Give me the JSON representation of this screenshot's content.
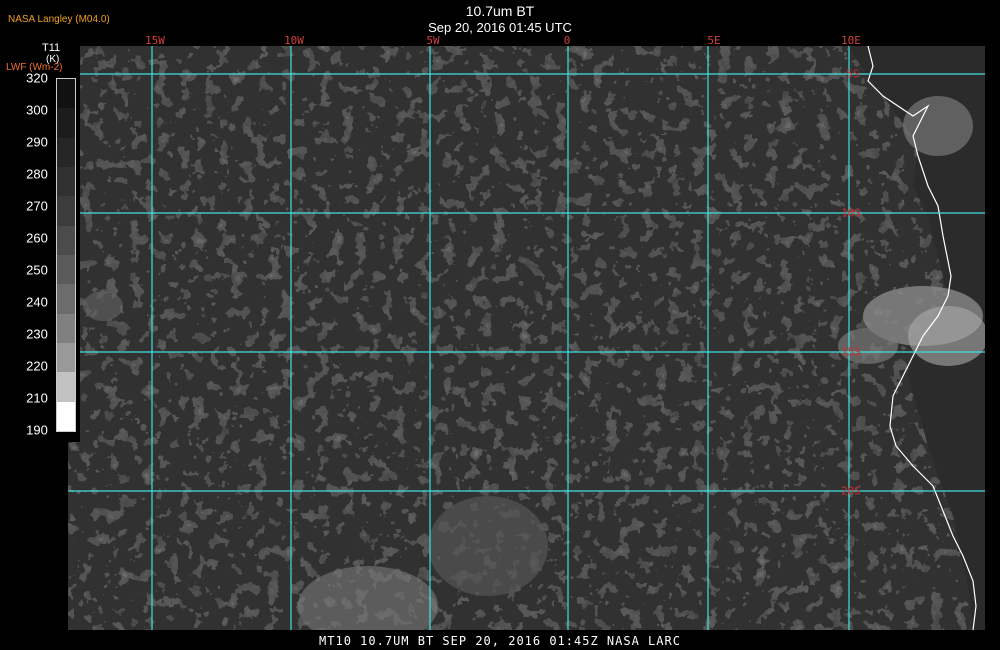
{
  "header": {
    "credit": "NASA Langley (M04.0)",
    "title": "10.7um BT",
    "datetime": "Sep 20, 2016 01:45 UTC"
  },
  "legend": {
    "variable": "T11",
    "unit": "(K)",
    "secondary": "LWF (Wm-2)",
    "ticks": [
      "320",
      "300",
      "290",
      "280",
      "270",
      "260",
      "250",
      "240",
      "230",
      "220",
      "210",
      "190"
    ],
    "colors": [
      "#111111",
      "#1c1c1c",
      "#262626",
      "#313131",
      "#3c3c3c",
      "#4b4b4b",
      "#5a5a5a",
      "#6c6c6c",
      "#808080",
      "#999999",
      "#c2c2c2",
      "#ffffff"
    ]
  },
  "map": {
    "grid_color": "#40e0e0",
    "coast_color": "#ffffff",
    "lon_labels": [
      "15W",
      "10W",
      "5W",
      "0",
      "5E",
      "10E"
    ],
    "lat_labels": [
      "5S",
      "10S",
      "15S",
      "20S"
    ]
  },
  "footer": {
    "text": "MT10  10.7UM BT   SEP 20, 2016 01:45Z  NASA LARC"
  }
}
